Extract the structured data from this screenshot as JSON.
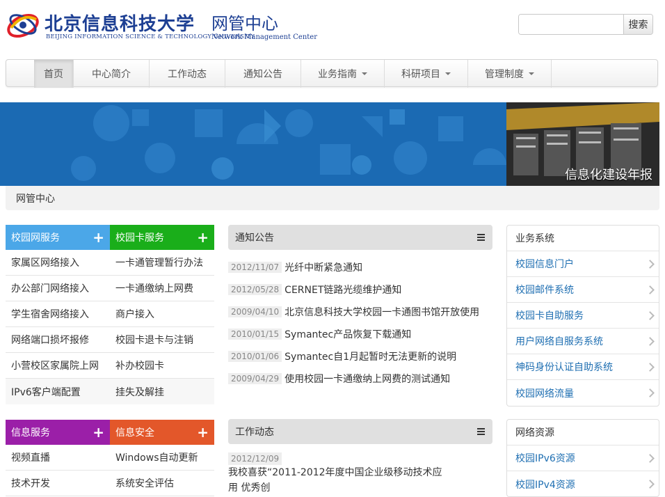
{
  "header": {
    "logo_cn": "北京信息科技大学",
    "logo_en": "BEIJING INFORMATION SCIENCE & TECHNOLOGY UNIVERSITY",
    "dept_cn": "网管中心",
    "dept_en": "Network Management Center",
    "search_placeholder": "",
    "search_button": "搜索"
  },
  "nav": {
    "items": [
      {
        "label": "首页"
      },
      {
        "label": "中心简介"
      },
      {
        "label": "工作动态"
      },
      {
        "label": "通知公告"
      },
      {
        "label": "业务指南"
      },
      {
        "label": "科研项目"
      },
      {
        "label": "管理制度"
      }
    ]
  },
  "banner": {
    "caption": "信息化建设年报"
  },
  "breadcrumb": "网管中心",
  "services": [
    {
      "title": "校园网服务",
      "color": "#4ba7e8",
      "items": [
        "家属区网络接入",
        "办公部门网络接入",
        "学生宿舍网络接入",
        "网络端口损坏报修",
        "小营校区家属院上网",
        "IPv6客户端配置"
      ]
    },
    {
      "title": "校园卡服务",
      "color": "#1aae1a",
      "items": [
        "一卡通管理暂行办法",
        "一卡通缴纳上网费",
        "商户接入",
        "校园卡退卡与注销",
        "补办校园卡",
        "挂失及解挂"
      ]
    },
    {
      "title": "信息服务",
      "color": "#9b1fa8",
      "items": [
        "视频直播",
        "技术开发"
      ]
    },
    {
      "title": "信息安全",
      "color": "#e3572a",
      "items": [
        "Windows自动更新",
        "系统安全评估"
      ]
    }
  ],
  "notices": {
    "title": "通知公告",
    "items": [
      {
        "date": "2012/11/07",
        "title": "光纤中断紧急通知"
      },
      {
        "date": "2012/05/28",
        "title": "CERNET链路光缆维护通知"
      },
      {
        "date": "2009/04/10",
        "title": "北京信息科技大学校园一卡通图书馆开放使用"
      },
      {
        "date": "2010/01/15",
        "title": "Symantec产品恢复下载通知"
      },
      {
        "date": "2010/01/06",
        "title": "Symantec自1月起暂时无法更新的说明"
      },
      {
        "date": "2009/04/29",
        "title": "使用校园一卡通缴纳上网费的测试通知"
      }
    ]
  },
  "work": {
    "title": "工作动态",
    "items": [
      {
        "date": "2012/12/09",
        "title": "我校喜获“2011-2012年度中国企业级移动技术应",
        "title2": "用 优秀创"
      }
    ]
  },
  "systems": {
    "title": "业务系统",
    "items": [
      "校园信息门户",
      "校园邮件系统",
      "校园卡自助服务",
      "用户网络自服务系统",
      "神码身份认证自助系统",
      "校园网络流量"
    ]
  },
  "resources": {
    "title": "网络资源",
    "items": [
      "校园IPv6资源",
      "校园IPv4资源"
    ]
  },
  "colors": {
    "brand": "#1d3f93",
    "link": "#1f6fb2",
    "banner": "#1d6cb4"
  }
}
